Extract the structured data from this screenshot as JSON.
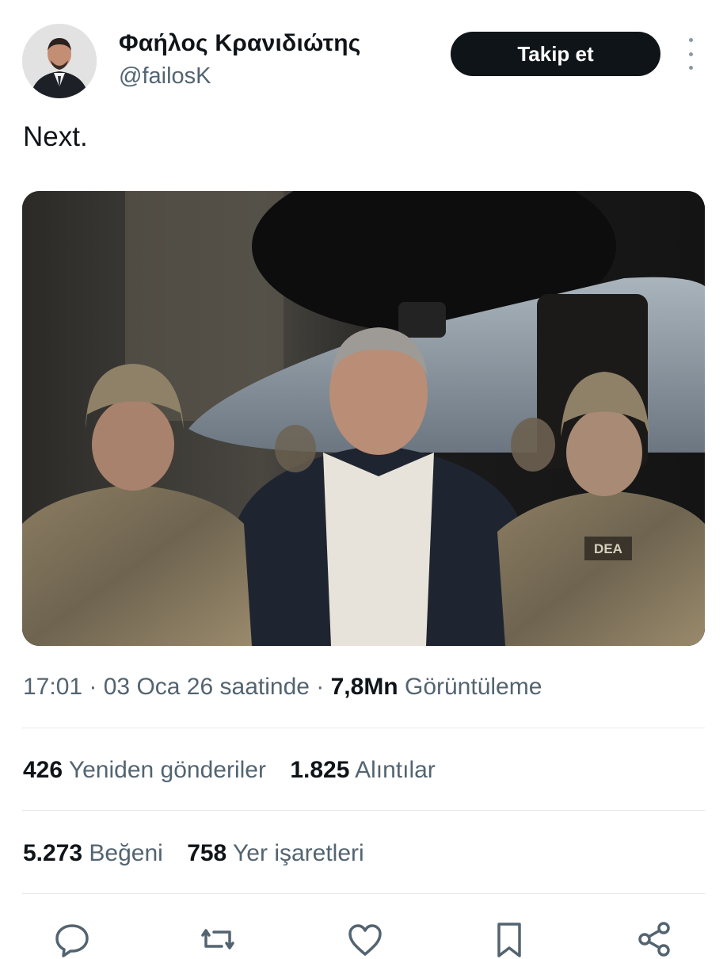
{
  "author": {
    "display_name": "Φαήλος Κρανιδιώτης",
    "handle": "@failosK"
  },
  "follow_label": "Takip et",
  "tweet": {
    "text": "Next."
  },
  "meta": {
    "time": "17:01",
    "date": "03 Oca 26 saatinde",
    "views_count": "7,8Mn",
    "views_label": "Görüntüleme"
  },
  "stats": {
    "reposts_count": "426",
    "reposts_label": "Yeniden gönderiler",
    "quotes_count": "1.825",
    "quotes_label": "Alıntılar",
    "likes_count": "5.273",
    "likes_label": "Beğeni",
    "bookmarks_count": "758",
    "bookmarks_label": "Yer işaretleri"
  },
  "media": {
    "patch_text": "DEA"
  },
  "colors": {
    "text_primary": "#0f1419",
    "text_secondary": "#536471",
    "button_bg": "#0f1419",
    "divider": "#e6e9ec"
  },
  "icons": [
    "more-vertical-icon",
    "reply-icon",
    "repost-icon",
    "like-icon",
    "bookmark-icon",
    "share-icon"
  ]
}
